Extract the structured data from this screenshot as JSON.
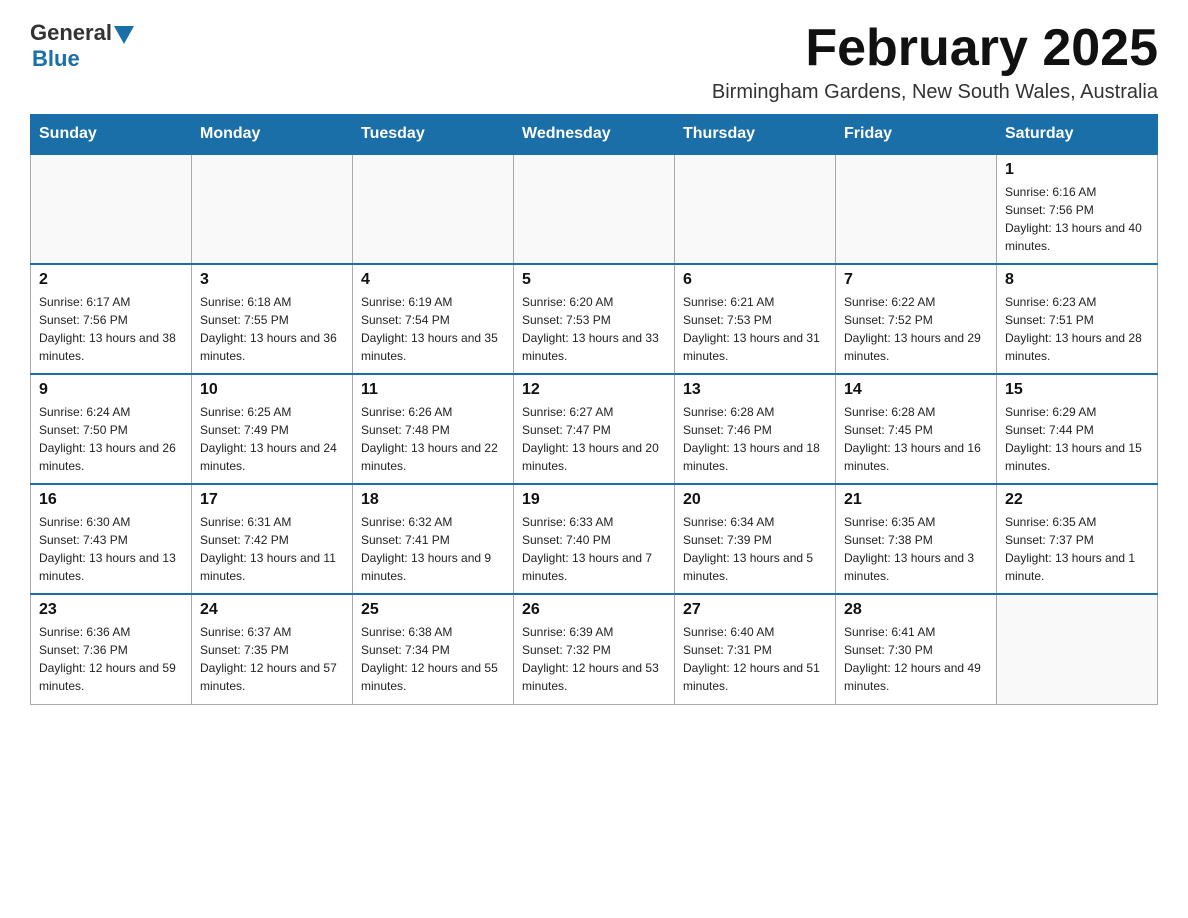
{
  "header": {
    "logo_general": "General",
    "logo_blue": "Blue",
    "month_title": "February 2025",
    "location": "Birmingham Gardens, New South Wales, Australia"
  },
  "days_of_week": [
    "Sunday",
    "Monday",
    "Tuesday",
    "Wednesday",
    "Thursday",
    "Friday",
    "Saturday"
  ],
  "weeks": [
    {
      "days": [
        {
          "num": "",
          "info": ""
        },
        {
          "num": "",
          "info": ""
        },
        {
          "num": "",
          "info": ""
        },
        {
          "num": "",
          "info": ""
        },
        {
          "num": "",
          "info": ""
        },
        {
          "num": "",
          "info": ""
        },
        {
          "num": "1",
          "info": "Sunrise: 6:16 AM\nSunset: 7:56 PM\nDaylight: 13 hours and 40 minutes."
        }
      ]
    },
    {
      "days": [
        {
          "num": "2",
          "info": "Sunrise: 6:17 AM\nSunset: 7:56 PM\nDaylight: 13 hours and 38 minutes."
        },
        {
          "num": "3",
          "info": "Sunrise: 6:18 AM\nSunset: 7:55 PM\nDaylight: 13 hours and 36 minutes."
        },
        {
          "num": "4",
          "info": "Sunrise: 6:19 AM\nSunset: 7:54 PM\nDaylight: 13 hours and 35 minutes."
        },
        {
          "num": "5",
          "info": "Sunrise: 6:20 AM\nSunset: 7:53 PM\nDaylight: 13 hours and 33 minutes."
        },
        {
          "num": "6",
          "info": "Sunrise: 6:21 AM\nSunset: 7:53 PM\nDaylight: 13 hours and 31 minutes."
        },
        {
          "num": "7",
          "info": "Sunrise: 6:22 AM\nSunset: 7:52 PM\nDaylight: 13 hours and 29 minutes."
        },
        {
          "num": "8",
          "info": "Sunrise: 6:23 AM\nSunset: 7:51 PM\nDaylight: 13 hours and 28 minutes."
        }
      ]
    },
    {
      "days": [
        {
          "num": "9",
          "info": "Sunrise: 6:24 AM\nSunset: 7:50 PM\nDaylight: 13 hours and 26 minutes."
        },
        {
          "num": "10",
          "info": "Sunrise: 6:25 AM\nSunset: 7:49 PM\nDaylight: 13 hours and 24 minutes."
        },
        {
          "num": "11",
          "info": "Sunrise: 6:26 AM\nSunset: 7:48 PM\nDaylight: 13 hours and 22 minutes."
        },
        {
          "num": "12",
          "info": "Sunrise: 6:27 AM\nSunset: 7:47 PM\nDaylight: 13 hours and 20 minutes."
        },
        {
          "num": "13",
          "info": "Sunrise: 6:28 AM\nSunset: 7:46 PM\nDaylight: 13 hours and 18 minutes."
        },
        {
          "num": "14",
          "info": "Sunrise: 6:28 AM\nSunset: 7:45 PM\nDaylight: 13 hours and 16 minutes."
        },
        {
          "num": "15",
          "info": "Sunrise: 6:29 AM\nSunset: 7:44 PM\nDaylight: 13 hours and 15 minutes."
        }
      ]
    },
    {
      "days": [
        {
          "num": "16",
          "info": "Sunrise: 6:30 AM\nSunset: 7:43 PM\nDaylight: 13 hours and 13 minutes."
        },
        {
          "num": "17",
          "info": "Sunrise: 6:31 AM\nSunset: 7:42 PM\nDaylight: 13 hours and 11 minutes."
        },
        {
          "num": "18",
          "info": "Sunrise: 6:32 AM\nSunset: 7:41 PM\nDaylight: 13 hours and 9 minutes."
        },
        {
          "num": "19",
          "info": "Sunrise: 6:33 AM\nSunset: 7:40 PM\nDaylight: 13 hours and 7 minutes."
        },
        {
          "num": "20",
          "info": "Sunrise: 6:34 AM\nSunset: 7:39 PM\nDaylight: 13 hours and 5 minutes."
        },
        {
          "num": "21",
          "info": "Sunrise: 6:35 AM\nSunset: 7:38 PM\nDaylight: 13 hours and 3 minutes."
        },
        {
          "num": "22",
          "info": "Sunrise: 6:35 AM\nSunset: 7:37 PM\nDaylight: 13 hours and 1 minute."
        }
      ]
    },
    {
      "days": [
        {
          "num": "23",
          "info": "Sunrise: 6:36 AM\nSunset: 7:36 PM\nDaylight: 12 hours and 59 minutes."
        },
        {
          "num": "24",
          "info": "Sunrise: 6:37 AM\nSunset: 7:35 PM\nDaylight: 12 hours and 57 minutes."
        },
        {
          "num": "25",
          "info": "Sunrise: 6:38 AM\nSunset: 7:34 PM\nDaylight: 12 hours and 55 minutes."
        },
        {
          "num": "26",
          "info": "Sunrise: 6:39 AM\nSunset: 7:32 PM\nDaylight: 12 hours and 53 minutes."
        },
        {
          "num": "27",
          "info": "Sunrise: 6:40 AM\nSunset: 7:31 PM\nDaylight: 12 hours and 51 minutes."
        },
        {
          "num": "28",
          "info": "Sunrise: 6:41 AM\nSunset: 7:30 PM\nDaylight: 12 hours and 49 minutes."
        },
        {
          "num": "",
          "info": ""
        }
      ]
    }
  ]
}
